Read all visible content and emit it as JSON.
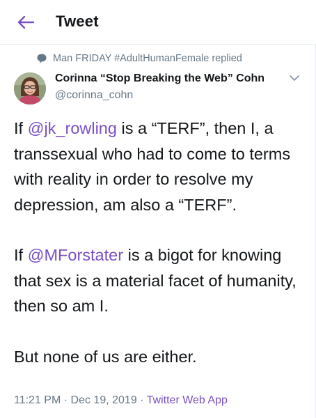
{
  "header": {
    "title": "Tweet",
    "back_icon": "arrow-left-icon",
    "accent": "#7a4fc4"
  },
  "reply_context": {
    "icon": "speech-bubble-icon",
    "text": "Man FRIDAY #AdultHumanFemale replied"
  },
  "tweet": {
    "author_name": "Corinna “Stop Breaking the Web” Cohn",
    "author_handle": "@corinna_cohn",
    "menu_icon": "chevron-down-icon",
    "p1_part1": "If ",
    "p1_mention": "@jk_rowling",
    "p1_part2": " is a “TERF”, then I, a transsexual who had to come to terms with reality in order to resolve my depression, am also a “TERF”.",
    "p2_part1": "If ",
    "p2_mention": "@MForstater",
    "p2_part2": " is a bigot for knowing that sex is a material facet of humanity, then so am I.",
    "p3": "But none of us are either.",
    "time": "11:21 PM",
    "separator": "·",
    "date": "Dec 19, 2019",
    "source": "Twitter Web App"
  }
}
